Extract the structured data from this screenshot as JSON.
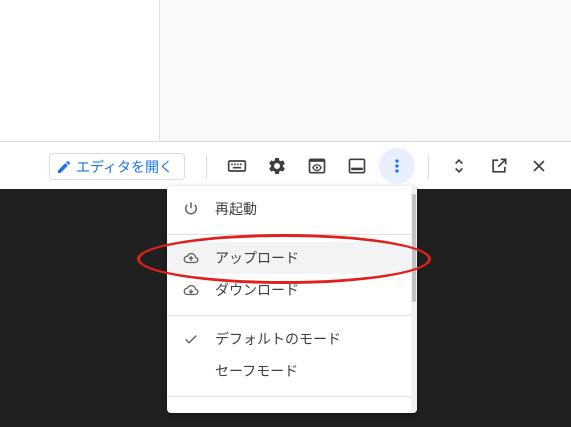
{
  "toolbar": {
    "open_editor_label": "エディタを開く",
    "icons": [
      "keyboard-icon",
      "settings-icon",
      "web-preview-icon",
      "panel-icon",
      "more-vert-icon",
      "expand-icon",
      "open-in-new-icon",
      "close-icon"
    ]
  },
  "menu": {
    "items": [
      {
        "label": "再起動",
        "icon": "power-icon"
      },
      {
        "label": "アップロード",
        "icon": "cloud-upload-icon"
      },
      {
        "label": "ダウンロード",
        "icon": "cloud-download-icon"
      },
      {
        "label": "デフォルトのモード",
        "icon": "check-icon"
      },
      {
        "label": "セーフモード",
        "icon": ""
      }
    ]
  },
  "colors": {
    "accent": "#1a73e8",
    "terminal_bg": "#202020",
    "highlight": "#e0201c",
    "icon": "#3c4043"
  }
}
